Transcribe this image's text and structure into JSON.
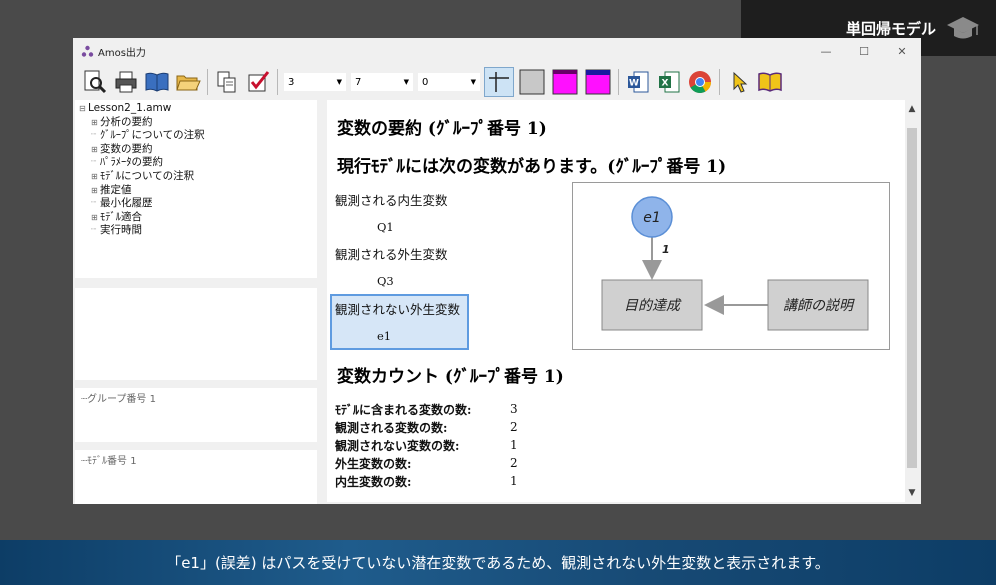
{
  "video": {
    "badge": "単回帰モデル"
  },
  "window": {
    "title": "Amos出力"
  },
  "toolbar": {
    "select1": "3",
    "select2": "7",
    "select3": "0"
  },
  "tree": {
    "items": [
      {
        "label": "Lesson2_1.amw",
        "level": 0,
        "expander": "⊟"
      },
      {
        "label": "分析の要約",
        "level": 1,
        "expander": "⊞"
      },
      {
        "label": "ｸﾞﾙｰﾌﾟについての注釈",
        "level": 1,
        "expander": ""
      },
      {
        "label": "変数の要約",
        "level": 1,
        "expander": "⊞"
      },
      {
        "label": "ﾊﾟﾗﾒｰﾀの要約",
        "level": 1,
        "expander": ""
      },
      {
        "label": "ﾓﾃﾞﾙについての注釈",
        "level": 1,
        "expander": "⊞"
      },
      {
        "label": "推定値",
        "level": 1,
        "expander": "⊞"
      },
      {
        "label": "最小化履歴",
        "level": 1,
        "expander": ""
      },
      {
        "label": "ﾓﾃﾞﾙ適合",
        "level": 1,
        "expander": "⊞"
      },
      {
        "label": "実行時間",
        "level": 1,
        "expander": ""
      }
    ]
  },
  "panes": {
    "group": "グループ番号 1",
    "model": "ﾓﾃﾞﾙ番号 1"
  },
  "content": {
    "heading1": "変数の要約 (ｸﾞﾙｰﾌﾟ番号 1)",
    "heading2": "現行ﾓﾃﾞﾙには次の変数があります。(ｸﾞﾙｰﾌﾟ番号 1)",
    "observed_endogenous_label": "観測される内生変数",
    "observed_endogenous_item": "Q1",
    "observed_exogenous_label": "観測される外生変数",
    "observed_exogenous_item": "Q3",
    "unobserved_exogenous_label": "観測されない外生変数",
    "unobserved_exogenous_item": "e1",
    "heading3": "変数カウント (ｸﾞﾙｰﾌﾟ番号 1)",
    "counts": [
      {
        "label": "ﾓﾃﾞﾙに含まれる変数の数:",
        "value": "3"
      },
      {
        "label": "観測される変数の数:",
        "value": "2"
      },
      {
        "label": "観測されない変数の数:",
        "value": "1"
      },
      {
        "label": "外生変数の数:",
        "value": "2"
      },
      {
        "label": "内生変数の数:",
        "value": "1"
      }
    ]
  },
  "diagram": {
    "error_node": "e1",
    "path_coefficient": "1",
    "dependent_node": "目的達成",
    "independent_node": "講師の説明"
  },
  "subtitle": "「e1」(誤差) はパスを受けていない潜在変数であるため、観測されない外生変数と表示されます。"
}
